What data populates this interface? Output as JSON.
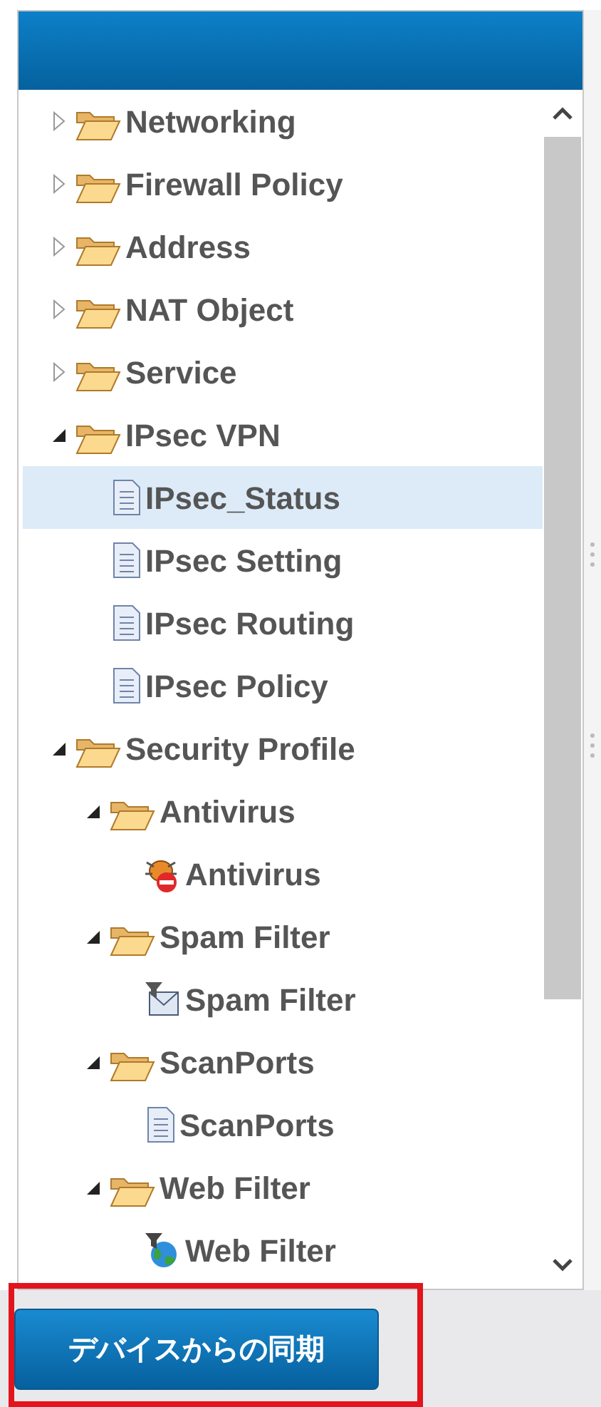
{
  "tree": [
    {
      "label": "Networking",
      "kind": "folder",
      "expanded": false,
      "selected": false
    },
    {
      "label": "Firewall Policy",
      "kind": "folder",
      "expanded": false,
      "selected": false
    },
    {
      "label": "Address",
      "kind": "folder",
      "expanded": false,
      "selected": false
    },
    {
      "label": "NAT Object",
      "kind": "folder",
      "expanded": false,
      "selected": false
    },
    {
      "label": "Service",
      "kind": "folder",
      "expanded": false,
      "selected": false
    },
    {
      "label": "IPsec VPN",
      "kind": "folder",
      "expanded": true,
      "selected": false,
      "children": [
        {
          "label": "IPsec_Status",
          "kind": "page",
          "selected": true
        },
        {
          "label": "IPsec Setting",
          "kind": "page",
          "selected": false
        },
        {
          "label": "IPsec Routing",
          "kind": "page",
          "selected": false
        },
        {
          "label": "IPsec Policy",
          "kind": "page",
          "selected": false
        }
      ]
    },
    {
      "label": "Security Profile",
      "kind": "folder",
      "expanded": true,
      "selected": false,
      "children": [
        {
          "label": "Antivirus",
          "kind": "folder",
          "expanded": true,
          "selected": false,
          "children": [
            {
              "label": "Antivirus",
              "kind": "antivirus",
              "selected": false
            }
          ]
        },
        {
          "label": "Spam Filter",
          "kind": "folder",
          "expanded": true,
          "selected": false,
          "children": [
            {
              "label": "Spam Filter",
              "kind": "spam",
              "selected": false
            }
          ]
        },
        {
          "label": "ScanPorts",
          "kind": "folder",
          "expanded": true,
          "selected": false,
          "children": [
            {
              "label": "ScanPorts",
              "kind": "page",
              "selected": false
            }
          ]
        },
        {
          "label": "Web Filter",
          "kind": "folder",
          "expanded": true,
          "selected": false,
          "children": [
            {
              "label": "Web Filter",
              "kind": "web",
              "selected": false
            }
          ]
        }
      ]
    }
  ],
  "sync_button": {
    "label": "デバイスからの同期",
    "highlighted": true
  }
}
